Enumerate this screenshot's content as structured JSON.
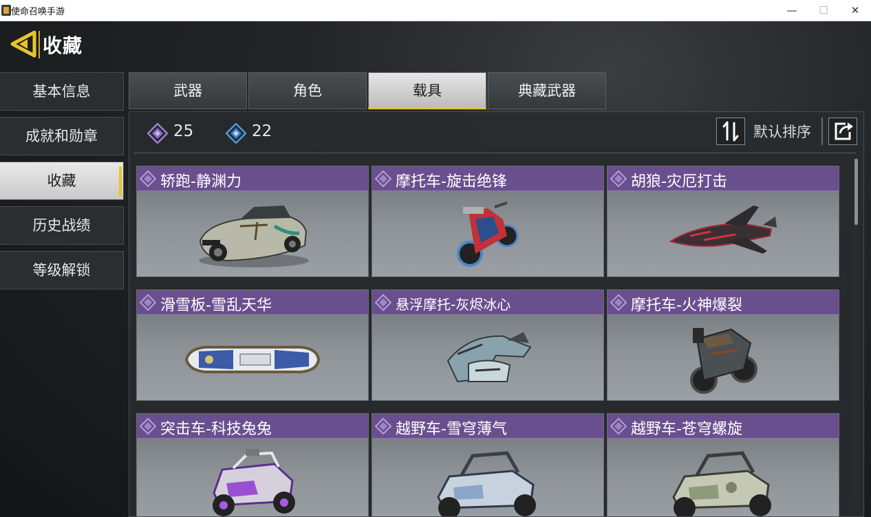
{
  "window": {
    "title": "使命召唤手游",
    "minimize_glyph": "—",
    "maximize_glyph": "☐",
    "close_glyph": "✕"
  },
  "header": {
    "title": "收藏",
    "back_icon": "chevron-left-icon",
    "accent_color": "#e7c52c"
  },
  "sidebar": {
    "items": [
      {
        "label": "基本信息",
        "active": false
      },
      {
        "label": "成就和勋章",
        "active": false
      },
      {
        "label": "收藏",
        "active": true
      },
      {
        "label": "历史战绩",
        "active": false
      },
      {
        "label": "等级解锁",
        "active": false
      }
    ]
  },
  "tabs": [
    {
      "label": "武器",
      "active": false
    },
    {
      "label": "角色",
      "active": false
    },
    {
      "label": "载具",
      "active": true
    },
    {
      "label": "典藏武器",
      "active": false
    }
  ],
  "stats": {
    "purple_count": "25",
    "blue_count": "22",
    "purple_color": "#8a6bc0",
    "blue_color": "#3a86d0"
  },
  "toolbar": {
    "sort_label": "默认排序",
    "sort_icon": "sort-arrows-icon",
    "share_icon": "share-icon"
  },
  "vehicles": [
    {
      "name": "轿跑-静渊力",
      "kind": "car"
    },
    {
      "name": "摩托车-旋击绝锋",
      "kind": "motorbike"
    },
    {
      "name": "胡狼-灾厄打击",
      "kind": "jet"
    },
    {
      "name": "滑雪板-雪乱天华",
      "kind": "snowboard"
    },
    {
      "name": "悬浮摩托-灰烬冰心",
      "kind": "hoverbike"
    },
    {
      "name": "摩托车-火神爆裂",
      "kind": "motorbike-dark"
    },
    {
      "name": "突击车-科技兔兔",
      "kind": "buggy-purple"
    },
    {
      "name": "越野车-雪穹薄气",
      "kind": "buggy-blue"
    },
    {
      "name": "越野车-苍穹螺旋",
      "kind": "buggy-camo"
    }
  ],
  "rarity_color": "#6a4f8e"
}
